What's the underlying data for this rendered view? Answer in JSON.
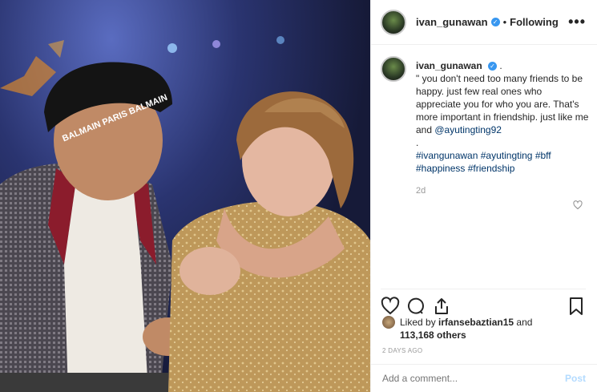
{
  "post": {
    "username": "ivan_gunawan",
    "verified_glyph": "✓",
    "separator": "•",
    "follow_status": "Following",
    "more_glyph": "•••"
  },
  "caption": {
    "username": "ivan_gunawan",
    "trailing": ".",
    "body": "\" you don't need too many friends to be happy. just few real ones who appreciate you for who you are. That's more important in friendship. just like me and ",
    "mention": "@ayutingting92",
    "dot_line": ".",
    "hashtags": [
      "#ivangunawan",
      "#ayutingting",
      "#bff",
      "#happiness",
      "#friendship"
    ],
    "time": "2d"
  },
  "likes": {
    "prefix": "Liked by ",
    "liker": "irfansebaztian15",
    "joiner": " and",
    "count": "113,168 others"
  },
  "timestamp": "2 DAYS AGO",
  "comment_box": {
    "placeholder": "Add a comment...",
    "post_label": "Post"
  },
  "photo": {
    "cap_text": "BALMAIN PARIS  BALMAIN"
  },
  "icons": [
    "heart-icon",
    "comment-icon",
    "share-icon",
    "bookmark-icon",
    "verified-icon",
    "more-options-icon"
  ],
  "colors": {
    "link": "#003569",
    "verified": "#3897f0",
    "post_button": "#b3dbff",
    "muted": "#999999"
  }
}
